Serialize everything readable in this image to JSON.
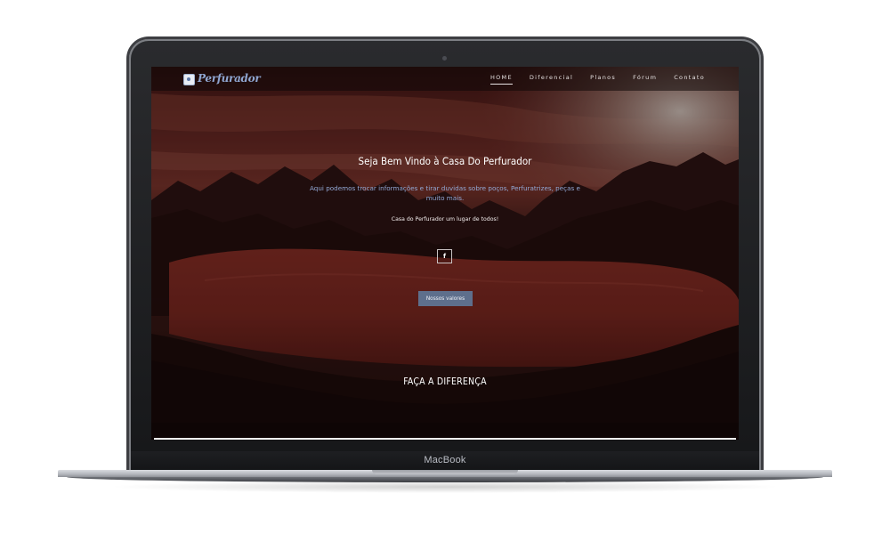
{
  "device": {
    "brand_label": "MacBook"
  },
  "site": {
    "logo": {
      "text": "Perfurador",
      "icon": "logo-badge-icon"
    },
    "nav": [
      {
        "label": "HOME",
        "active": true
      },
      {
        "label": "Diferencial",
        "active": false
      },
      {
        "label": "Planos",
        "active": false
      },
      {
        "label": "Fórum",
        "active": false
      },
      {
        "label": "Contato",
        "active": false
      }
    ],
    "hero": {
      "title": "Seja Bem Vindo à Casa Do Perfurador",
      "subtitle": "Aqui podemos trocar informações e tirar duvidas sobre poços, Perfuratrizes, peças e muito mais.",
      "tagline": "Casa do Perfurador um lugar de todos!",
      "facebook_label": "f",
      "facebook_icon": "facebook-icon",
      "cta_label": "Nossos valores"
    },
    "section_title": "FAÇA A DIFERENÇA"
  },
  "colors": {
    "accent_blue": "#93a9d6",
    "button_bg": "#5e6f8c",
    "hero_tint": "#6b2a24"
  }
}
